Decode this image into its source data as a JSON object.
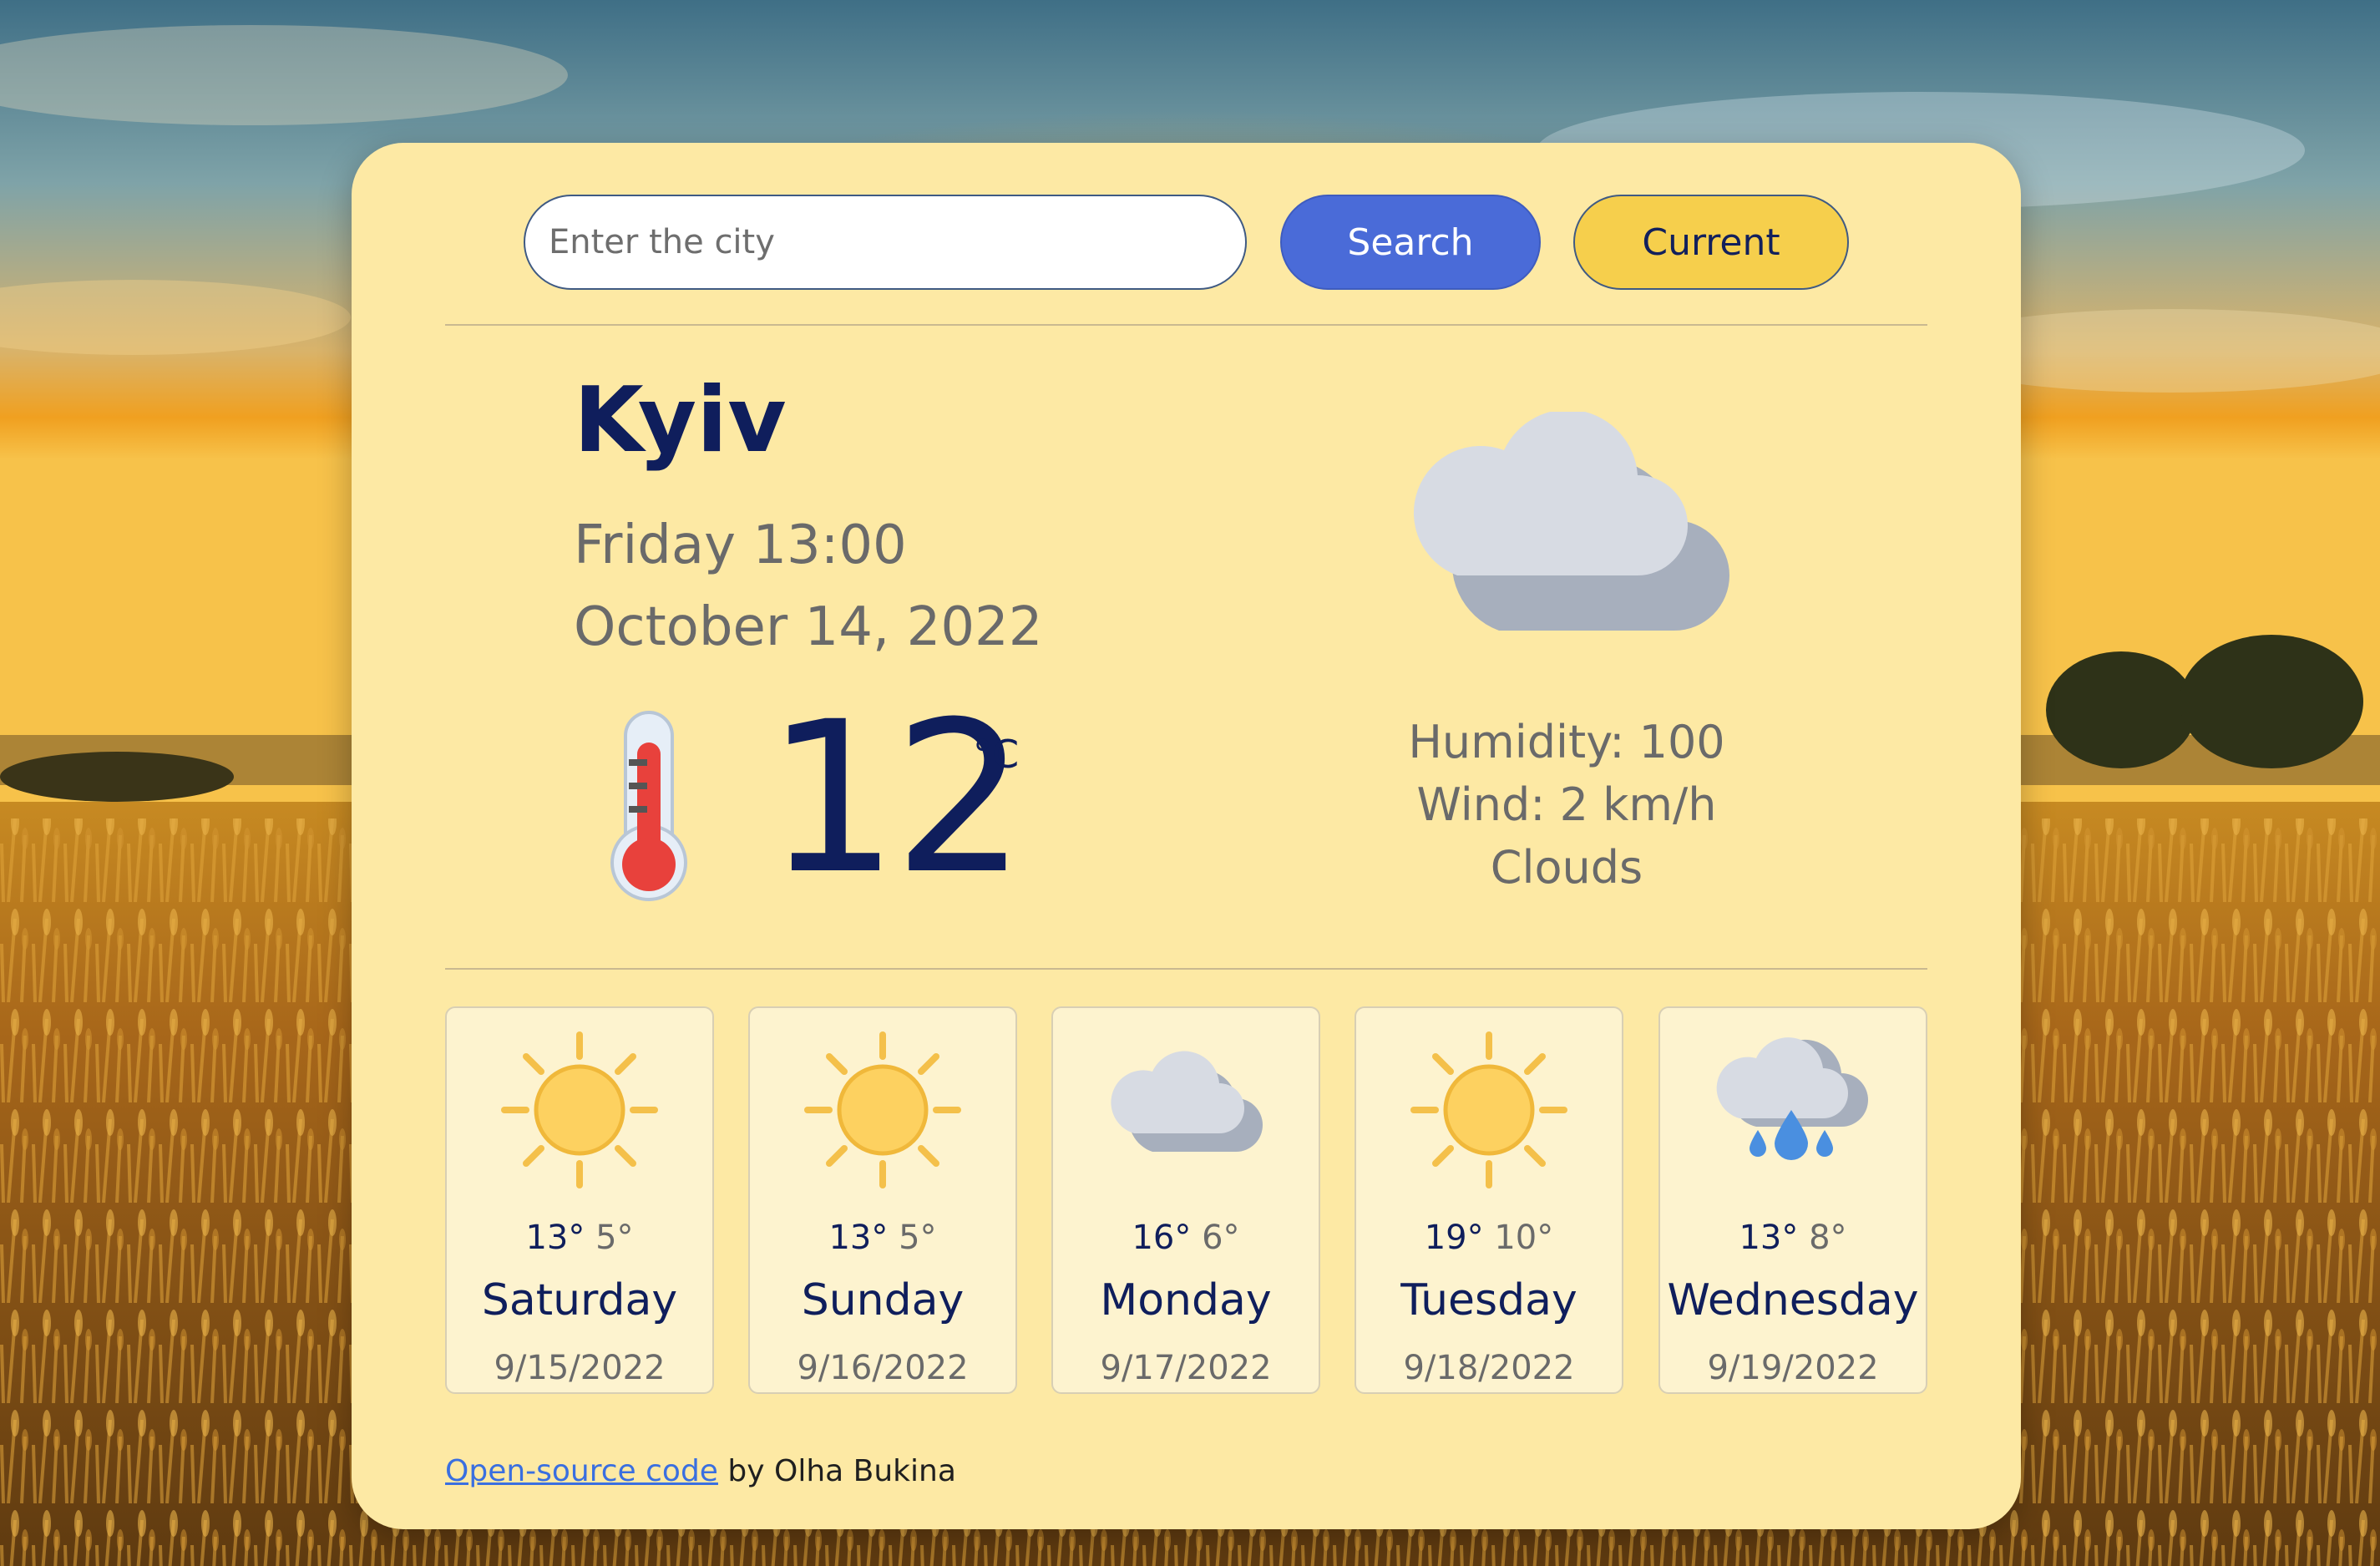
{
  "search": {
    "placeholder": "Enter the city",
    "search_label": "Search",
    "current_label": "Current"
  },
  "current": {
    "city": "Kyiv",
    "day_time": "Friday 13:00",
    "date": "October 14, 2022",
    "temperature": "12",
    "unit": "°C",
    "humidity": "Humidity: 100",
    "wind": "Wind: 2 km/h",
    "description": "Clouds",
    "icon": "cloudy-icon"
  },
  "forecast": [
    {
      "icon": "sun-icon",
      "max": "13°",
      "min": "5°",
      "day": "Saturday",
      "date": "9/15/2022"
    },
    {
      "icon": "sun-icon",
      "max": "13°",
      "min": "5°",
      "day": "Sunday",
      "date": "9/16/2022"
    },
    {
      "icon": "cloudy-icon",
      "max": "16°",
      "min": "6°",
      "day": "Monday",
      "date": "9/17/2022"
    },
    {
      "icon": "sun-icon",
      "max": "19°",
      "min": "10°",
      "day": "Tuesday",
      "date": "9/18/2022"
    },
    {
      "icon": "rain-cloud-icon",
      "max": "13°",
      "min": "8°",
      "day": "Wednesday",
      "date": "9/19/2022"
    }
  ],
  "footer": {
    "link_text": "Open-source code",
    "by_text": " by Olha Bukina"
  },
  "colors": {
    "card": "#fde9a4",
    "accent_blue": "#4a6bd8",
    "accent_yellow": "#f6cf4c",
    "navy": "#0f1e5c"
  }
}
